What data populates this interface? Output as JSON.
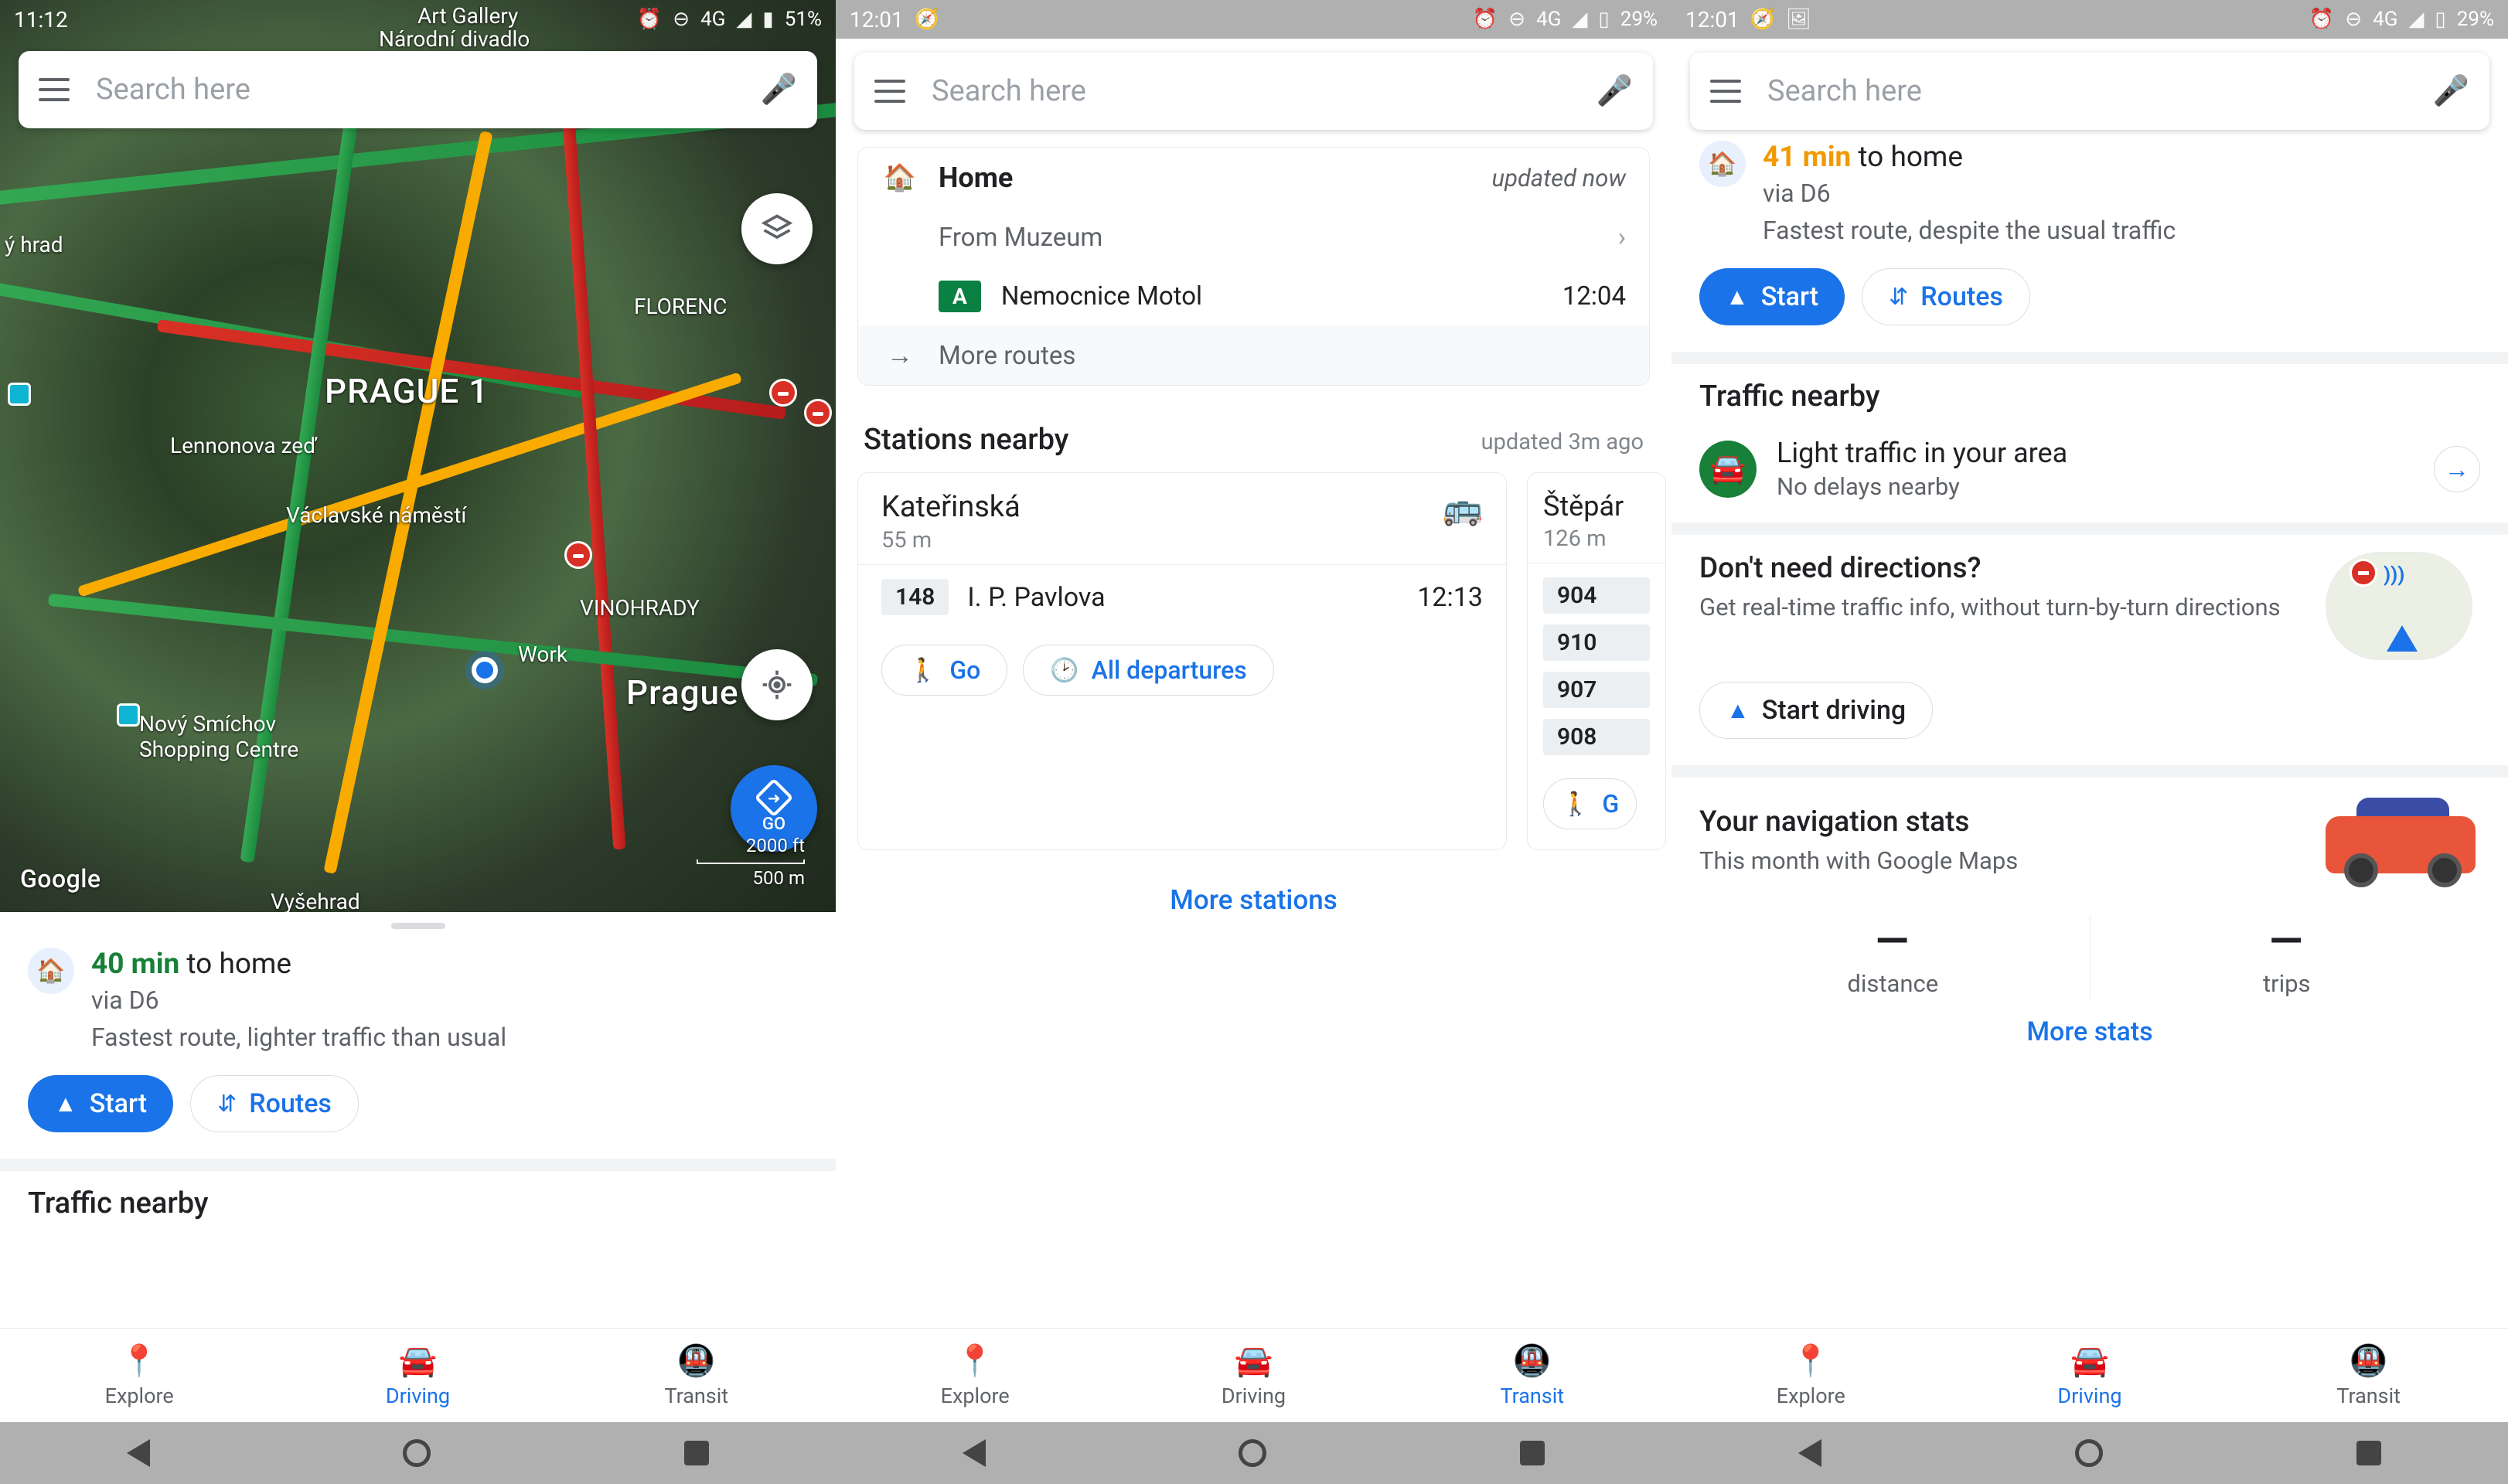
{
  "panel1": {
    "status": {
      "time": "11:12",
      "net": "4G",
      "battery": "51%"
    },
    "search_placeholder": "Search here",
    "map": {
      "labels": {
        "art_gallery": "Art Gallery",
        "narodni": "Národní divadlo",
        "florenc": "FLORENC",
        "prague1": "PRAGUE 1",
        "lennon": "Lennonova zeď",
        "vaclav": "Václavské náměstí",
        "vinohrady": "VINOHRADY",
        "work": "Work",
        "prague": "Prague",
        "smichov": "Nový Smíchov\nShopping Centre",
        "vysehrad": "Vyšehrad",
        "hrad": "ý hrad"
      },
      "scale_ft": "2000 ft",
      "scale_m": "500 m",
      "logo": "Google",
      "go": "GO"
    },
    "commute": {
      "time": "40 min",
      "dest": "to home",
      "via": "via D6",
      "note": "Fastest route, lighter traffic than usual"
    },
    "buttons": {
      "start": "Start",
      "routes": "Routes"
    },
    "traffic_nearby": "Traffic nearby",
    "nav": {
      "explore": "Explore",
      "driving": "Driving",
      "transit": "Transit"
    }
  },
  "panel2": {
    "status": {
      "time": "12:01",
      "net": "4G",
      "battery": "29%"
    },
    "search_placeholder": "Search here",
    "home_card": {
      "title": "Home",
      "updated": "updated now",
      "from": "From Muzeum",
      "line": "A",
      "line_dest": "Nemocnice Motol",
      "line_time": "12:04",
      "more_routes": "More routes"
    },
    "stations": {
      "title": "Stations nearby",
      "updated": "updated 3m ago",
      "more": "More stations",
      "card1": {
        "name": "Kateřinská",
        "dist": "55 m",
        "dep_route": "148",
        "dep_dest": "I. P. Pavlova",
        "dep_time": "12:13",
        "go": "Go",
        "all": "All departures"
      },
      "card2": {
        "name": "Štěpár",
        "dist": "126 m",
        "routes": [
          "904",
          "910",
          "907",
          "908"
        ],
        "go": "G"
      }
    },
    "nav": {
      "explore": "Explore",
      "driving": "Driving",
      "transit": "Transit"
    }
  },
  "panel3": {
    "status": {
      "time": "12:01",
      "net": "4G",
      "battery": "29%"
    },
    "search_placeholder": "Search here",
    "commute": {
      "time": "41 min",
      "dest": "to home",
      "via": "via D6",
      "note": "Fastest route, despite the usual traffic"
    },
    "buttons": {
      "start": "Start",
      "routes": "Routes"
    },
    "traffic": {
      "heading": "Traffic nearby",
      "title": "Light traffic in your area",
      "sub": "No delays nearby"
    },
    "promo": {
      "heading": "Don't need directions?",
      "sub": "Get real-time traffic info, without turn-by-turn directions",
      "button": "Start driving"
    },
    "stats": {
      "heading": "Your navigation stats",
      "sub": "This month with Google Maps",
      "distance_val": "—",
      "distance_lab": "distance",
      "trips_val": "—",
      "trips_lab": "trips",
      "more": "More stats"
    },
    "nav": {
      "explore": "Explore",
      "driving": "Driving",
      "transit": "Transit"
    }
  }
}
